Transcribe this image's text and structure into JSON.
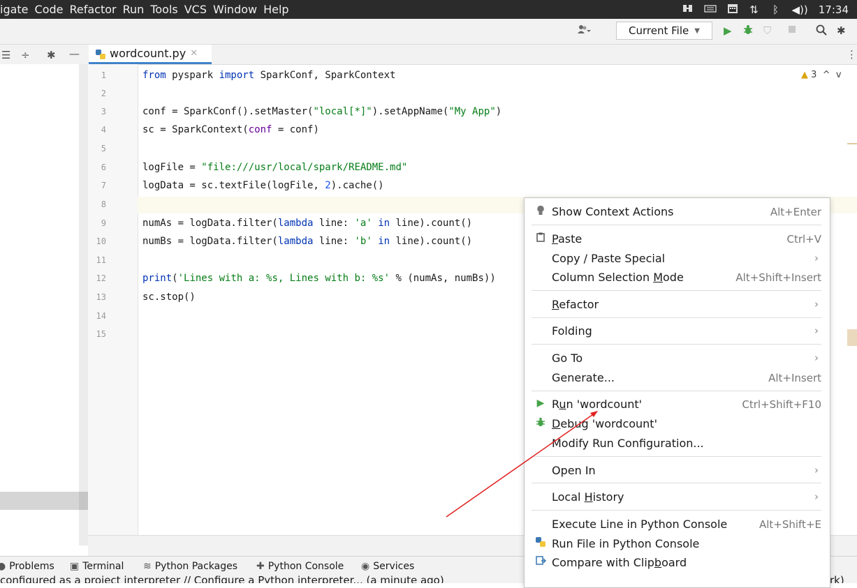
{
  "menubar": {
    "items": [
      "igate",
      "Code",
      "Refactor",
      "Run",
      "Tools",
      "VCS",
      "Window",
      "Help"
    ],
    "clock": "17:34"
  },
  "toolbar": {
    "run_config": "Current File"
  },
  "editor": {
    "tab_title": "wordcount.py",
    "inspections_count": "3",
    "line_numbers": [
      "1",
      "2",
      "3",
      "4",
      "5",
      "6",
      "7",
      "8",
      "9",
      "10",
      "11",
      "12",
      "13",
      "14",
      "15"
    ],
    "lines": [
      {
        "t": "from pyspark import SparkConf, SparkContext"
      },
      {
        "t": ""
      },
      {
        "t": "conf = SparkConf().setMaster(\"local[*]\").setAppName(\"My App\")"
      },
      {
        "t": "sc = SparkContext(conf = conf)"
      },
      {
        "t": ""
      },
      {
        "t": "logFile = \"file:///usr/local/spark/README.md\""
      },
      {
        "t": "logData = sc.textFile(logFile, 2).cache()"
      },
      {
        "t": ""
      },
      {
        "t": "numAs = logData.filter(lambda line: 'a' in line).count()"
      },
      {
        "t": "numBs = logData.filter(lambda line: 'b' in line).count()"
      },
      {
        "t": ""
      },
      {
        "t": "print('Lines with a: %s, Lines with b: %s' % (numAs, numBs))"
      },
      {
        "t": "sc.stop()"
      },
      {
        "t": ""
      },
      {
        "t": ""
      }
    ]
  },
  "context_menu": {
    "items": [
      {
        "id": "show-context-actions",
        "label": "Show Context Actions",
        "shortcut": "Alt+Enter",
        "icon": "lightbulb-icon"
      },
      {
        "id": "paste",
        "label": "Paste",
        "shortcut": "Ctrl+V",
        "icon": "clipboard-icon"
      },
      {
        "id": "copy-paste-special",
        "label": "Copy / Paste Special",
        "submenu": true
      },
      {
        "id": "column-selection-mode",
        "label": "Column Selection Mode",
        "shortcut": "Alt+Shift+Insert"
      },
      {
        "id": "refactor",
        "label": "Refactor",
        "submenu": true
      },
      {
        "id": "folding",
        "label": "Folding",
        "submenu": true
      },
      {
        "id": "go-to",
        "label": "Go To",
        "submenu": true
      },
      {
        "id": "generate",
        "label": "Generate...",
        "shortcut": "Alt+Insert"
      },
      {
        "id": "run",
        "label": "Run 'wordcount'",
        "shortcut": "Ctrl+Shift+F10",
        "icon": "run-icon"
      },
      {
        "id": "debug",
        "label": "Debug 'wordcount'",
        "icon": "debug-icon"
      },
      {
        "id": "modify-run-configuration",
        "label": "Modify Run Configuration..."
      },
      {
        "id": "open-in",
        "label": "Open In",
        "submenu": true
      },
      {
        "id": "local-history",
        "label": "Local History",
        "submenu": true
      },
      {
        "id": "execute-line-in-python-console",
        "label": "Execute Line in Python Console",
        "shortcut": "Alt+Shift+E"
      },
      {
        "id": "run-file-in-python-console",
        "label": "Run File in Python Console",
        "icon": "python-icon"
      },
      {
        "id": "compare-with-clipboard",
        "label": "Compare with Clipboard",
        "icon": "compare-icon"
      }
    ]
  },
  "bottom_tools": [
    "Problems",
    "Terminal",
    "Python Packages",
    "Python Console",
    "Services"
  ],
  "status": {
    "message": "configured as a project interpreter // Configure a Python interpreter... (a minute ago)",
    "right_text": "rk)"
  },
  "colors": {
    "accent": "#4083c9",
    "run_green": "#45a348",
    "annotation_arrow": "#e02020"
  }
}
